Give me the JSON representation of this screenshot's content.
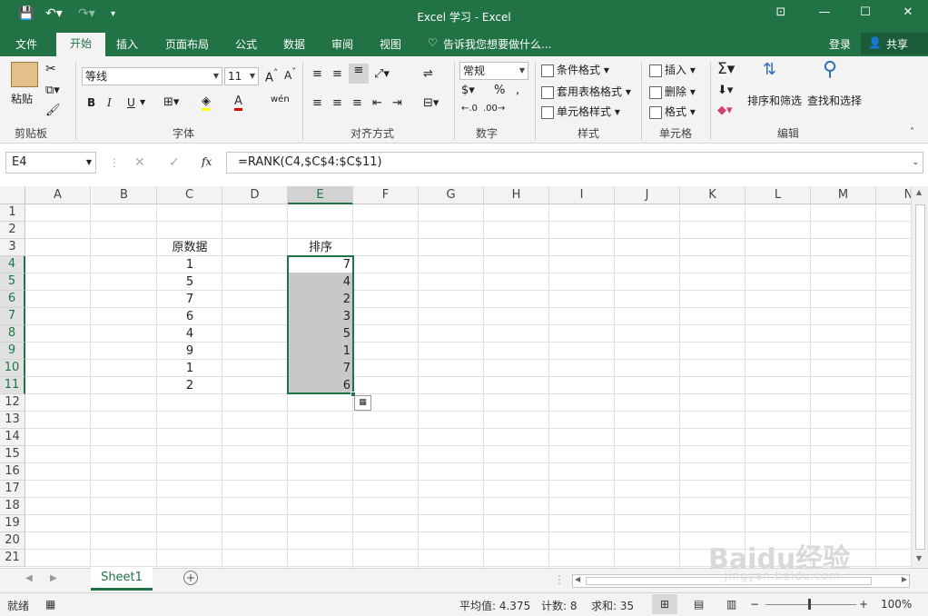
{
  "window": {
    "title": "Excel 学习 - Excel"
  },
  "ribbon_tabs": [
    "文件",
    "开始",
    "插入",
    "页面布局",
    "公式",
    "数据",
    "审阅",
    "视图"
  ],
  "tell_me": "告诉我您想要做什么...",
  "account": {
    "login": "登录",
    "share": "共享"
  },
  "ribbon": {
    "clipboard": {
      "label": "剪贴板",
      "paste": "粘贴"
    },
    "font": {
      "label": "字体",
      "name": "等线",
      "size": "11",
      "bold": "B",
      "italic": "I",
      "underline": "U"
    },
    "alignment": {
      "label": "对齐方式"
    },
    "number": {
      "label": "数字",
      "format": "常规",
      "percent": "%"
    },
    "styles": {
      "label": "样式",
      "conditional": "条件格式",
      "table": "套用表格格式",
      "cell_styles": "单元格样式"
    },
    "cells": {
      "label": "单元格",
      "insert": "插入",
      "delete": "删除",
      "format": "格式"
    },
    "editing": {
      "label": "编辑",
      "sort_filter": "排序和筛选",
      "find_select": "查找和选择"
    }
  },
  "formula_bar": {
    "name_box": "E4",
    "fx": "fx",
    "formula": "=RANK(C4,$C$4:$C$11)"
  },
  "columns": [
    "A",
    "B",
    "C",
    "D",
    "E",
    "F",
    "G",
    "H",
    "I",
    "J",
    "K",
    "L",
    "M",
    "N"
  ],
  "rows": [
    "1",
    "2",
    "3",
    "4",
    "5",
    "6",
    "7",
    "8",
    "9",
    "10",
    "11",
    "12",
    "13",
    "14",
    "15",
    "16",
    "17",
    "18",
    "19",
    "20",
    "21"
  ],
  "cells": {
    "C3": "原数据",
    "E3": "排序",
    "C": [
      "1",
      "5",
      "7",
      "6",
      "4",
      "9",
      "1",
      "2"
    ],
    "E": [
      "7",
      "4",
      "2",
      "3",
      "5",
      "1",
      "7",
      "6"
    ]
  },
  "sheets": [
    "Sheet1"
  ],
  "status": {
    "ready": "就绪",
    "average": "平均值: 4.375",
    "count": "计数: 8",
    "sum": "求和: 35",
    "zoom": "100%"
  },
  "watermark": {
    "brand": "Baidu经验",
    "url": "jingyan.baidu.com"
  },
  "colors": {
    "accent": "#217346",
    "selection": "#c8c8c8"
  },
  "icons": [
    "save-icon",
    "undo-icon",
    "redo-icon",
    "lightbulb-icon",
    "user-icon",
    "paste-icon",
    "cut-icon",
    "copy-icon",
    "format-painter-icon",
    "sum-icon",
    "sort-filter-icon",
    "find-icon",
    "add-sheet-icon",
    "quick-analysis-icon"
  ]
}
